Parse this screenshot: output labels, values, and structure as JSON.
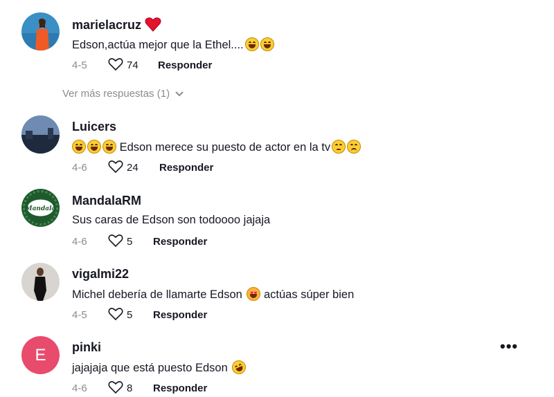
{
  "comments": [
    {
      "username": "marielacruz",
      "text": "Edson,actúa mejor que la Ethel....",
      "date": "4-5",
      "likes": "74",
      "reply_label": "Responder"
    },
    {
      "username": "Luicers",
      "text": "Edson merece su puesto de actor en la tv",
      "date": "4-6",
      "likes": "24",
      "reply_label": "Responder"
    },
    {
      "username": "MandalaRM",
      "text": "Sus caras de Edson son todoooo jajaja",
      "date": "4-6",
      "likes": "5",
      "reply_label": "Responder",
      "avatar_text": "Mandala"
    },
    {
      "username": "vigalmi22",
      "text_before": "Michel debería de llamarte Edson",
      "text_after": "actúas súper bien",
      "date": "4-5",
      "likes": "5",
      "reply_label": "Responder"
    },
    {
      "username": "pinki",
      "text": "jajajaja que está puesto Edson",
      "date": "4-6",
      "likes": "8",
      "reply_label": "Responder",
      "avatar_letter": "E"
    }
  ],
  "view_more_replies": "Ver más respuestas (1)",
  "icons": [
    "heart-icon",
    "chevron-down-icon",
    "more-options-icon",
    "emoji-icon"
  ],
  "colors": {
    "avatar_pinki": "#e84b6c",
    "secondary_text": "#8a8b91",
    "verified_heart": "#e0245e"
  }
}
